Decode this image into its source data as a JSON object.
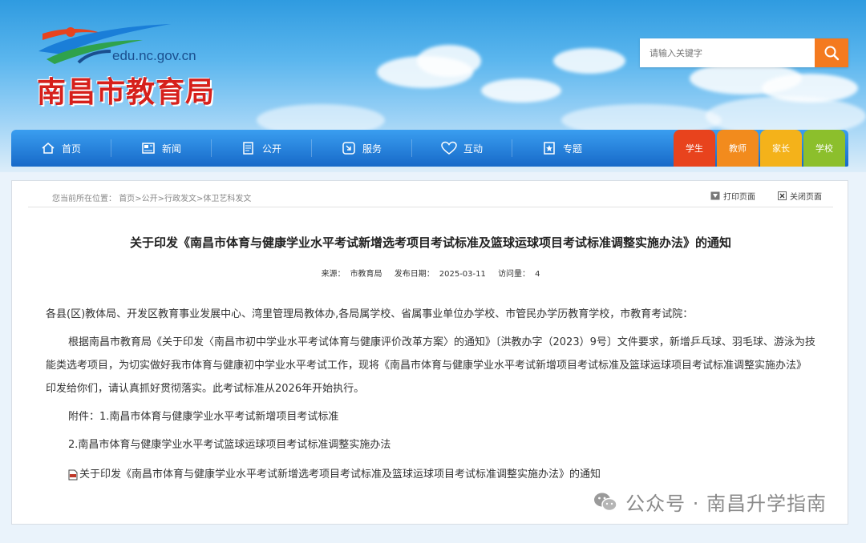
{
  "header": {
    "domain": "edu.nc.gov.cn",
    "site_title": "南昌市教育局",
    "search_placeholder": "请输入关键字"
  },
  "nav": {
    "items": [
      {
        "label": "首页",
        "icon": "home-icon"
      },
      {
        "label": "新闻",
        "icon": "news-icon"
      },
      {
        "label": "公开",
        "icon": "document-icon"
      },
      {
        "label": "服务",
        "icon": "service-icon"
      },
      {
        "label": "互动",
        "icon": "heart-icon"
      },
      {
        "label": "专题",
        "icon": "topic-icon"
      }
    ],
    "roles": [
      {
        "label": "学生",
        "color": "#e8431d"
      },
      {
        "label": "教师",
        "color": "#f28b1d"
      },
      {
        "label": "家长",
        "color": "#f4b21a"
      },
      {
        "label": "学校",
        "color": "#8cbf2c"
      }
    ]
  },
  "breadcrumb": {
    "prefix": "您当前所在位置：",
    "items": [
      "首页",
      "公开",
      "行政发文",
      "体卫艺科发文"
    ],
    "sep": ">"
  },
  "tools": {
    "print": "打印页面",
    "close": "关闭页面"
  },
  "article": {
    "title": "关于印发《南昌市体育与健康学业水平考试新增选考项目考试标准及篮球运球项目考试标准调整实施办法》的通知",
    "source_label": "来源：",
    "source": "市教育局",
    "date_label": "发布日期：",
    "date": "2025-03-11",
    "visits_label": "访问量：",
    "visits": "4",
    "addressees": "各县(区)教体局、开发区教育事业发展中心、湾里管理局教体办,各局属学校、省属事业单位办学校、市管民办学历教育学校，市教育考试院：",
    "paragraph": "根据南昌市教育局《关于印发〈南昌市初中学业水平考试体育与健康评价改革方案〉的通知》〔洪教办字（2023）9号〕文件要求，新增乒乓球、羽毛球、游泳为技能类选考项目，为切实做好我市体育与健康初中学业水平考试工作，现将《南昌市体育与健康学业水平考试新增项目考试标准及篮球运球项目考试标准调整实施办法》印发给你们，请认真抓好贯彻落实。此考试标准从2026年开始执行。",
    "attach_1": "附件：1.南昌市体育与健康学业水平考试新增项目考试标准",
    "attach_2": "2.南昌市体育与健康学业水平考试篮球运球项目考试标准调整实施办法",
    "attach_link": "关于印发《南昌市体育与健康学业水平考试新增选考项目考试标准及篮球运球项目考试标准调整实施办法》的通知"
  },
  "watermark": {
    "text": "公众号 · 南昌升学指南"
  }
}
